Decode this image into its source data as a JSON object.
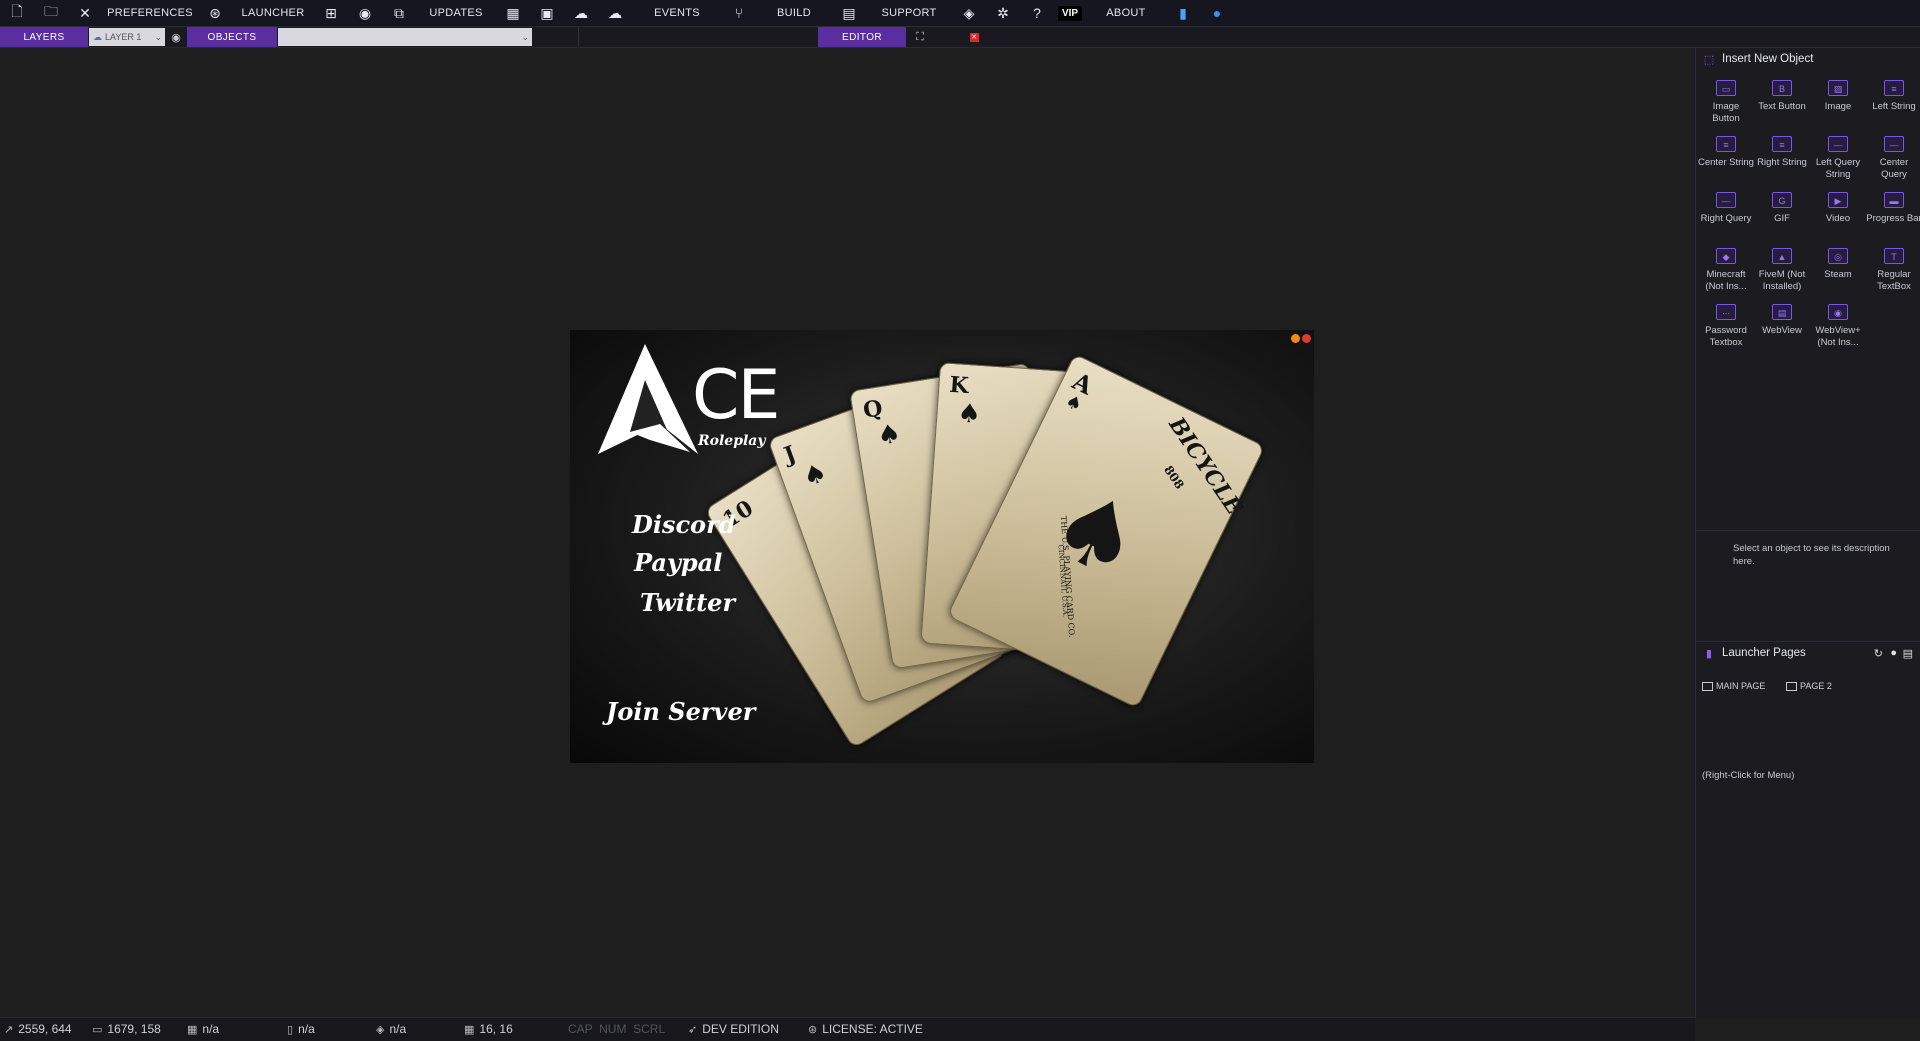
{
  "menubar": {
    "items": [
      {
        "type": "icon",
        "name": "new-file-icon",
        "glyph": "🗋"
      },
      {
        "type": "icon",
        "name": "open-folder-icon",
        "glyph": "🗀"
      },
      {
        "type": "icon",
        "name": "close-x-icon",
        "glyph": "✕"
      },
      {
        "type": "text",
        "label": "PREFERENCES"
      },
      {
        "type": "icon",
        "name": "globe-settings-icon",
        "glyph": "⊛"
      },
      {
        "type": "text",
        "label": "LAUNCHER"
      },
      {
        "type": "icon",
        "name": "hierarchy-icon",
        "glyph": "⊞"
      },
      {
        "type": "icon",
        "name": "record-icon",
        "glyph": "◉"
      },
      {
        "type": "icon",
        "name": "preview-window-icon",
        "glyph": "⧉"
      },
      {
        "type": "text",
        "label": "UPDATES"
      },
      {
        "type": "icon",
        "name": "grid-icon",
        "glyph": "▦"
      },
      {
        "type": "icon",
        "name": "archive-icon",
        "glyph": "▣"
      },
      {
        "type": "icon",
        "name": "cloud-upload-icon",
        "glyph": "☁"
      },
      {
        "type": "icon",
        "name": "cloud-icon",
        "glyph": "☁"
      },
      {
        "type": "text",
        "label": "EVENTS"
      },
      {
        "type": "icon",
        "name": "branch-icon",
        "glyph": "⑂"
      },
      {
        "type": "text",
        "label": "BUILD"
      },
      {
        "type": "icon",
        "name": "package-icon",
        "glyph": "▤"
      },
      {
        "type": "text",
        "label": "SUPPORT"
      },
      {
        "type": "icon",
        "name": "discord-icon",
        "glyph": "◈"
      },
      {
        "type": "icon",
        "name": "bug-icon",
        "glyph": "✲"
      },
      {
        "type": "icon",
        "name": "help-icon",
        "glyph": "?"
      },
      {
        "type": "vip",
        "label": "VIP"
      },
      {
        "type": "text",
        "label": "ABOUT"
      },
      {
        "type": "icon",
        "name": "book-icon",
        "glyph": "▮"
      },
      {
        "type": "icon",
        "name": "user-circle-icon",
        "glyph": "●"
      }
    ]
  },
  "toolbar": {
    "layers_label": "LAYERS",
    "layer_value": "LAYER 1",
    "objects_label": "OBJECTS",
    "objects_value": "",
    "editor_label": "EDITOR"
  },
  "launcher": {
    "logo_text": "CE",
    "logo_sub": "Roleplay",
    "links": [
      "Discord",
      "Paypal",
      "Twitter"
    ],
    "join": "Join Server",
    "card_brand": "BICYCLE",
    "card_num": "808",
    "card_maker": "THE U.S. PLAYING CARD CO.",
    "card_city": "CINCINNATI, U.S.A."
  },
  "insert_panel": {
    "title": "Insert New Object",
    "objects": [
      {
        "label": "Image Button",
        "icon": "image-button-icon",
        "glyph": "▭"
      },
      {
        "label": "Text Button",
        "icon": "text-button-icon",
        "glyph": "B"
      },
      {
        "label": "Image",
        "icon": "image-icon",
        "glyph": "▨"
      },
      {
        "label": "Left String",
        "icon": "left-string-icon",
        "glyph": "≡"
      },
      {
        "label": "Center String",
        "icon": "center-string-icon",
        "glyph": "≡"
      },
      {
        "label": "Right String",
        "icon": "right-string-icon",
        "glyph": "≡"
      },
      {
        "label": "Left Query String",
        "icon": "left-query-icon",
        "glyph": "—"
      },
      {
        "label": "Center Query",
        "icon": "center-query-icon",
        "glyph": "—"
      },
      {
        "label": "Right Query",
        "icon": "right-query-icon",
        "glyph": "—"
      },
      {
        "label": "GIF",
        "icon": "gif-icon",
        "glyph": "G"
      },
      {
        "label": "Video",
        "icon": "video-icon",
        "glyph": "▶"
      },
      {
        "label": "Progress Bar",
        "icon": "progress-bar-icon",
        "glyph": "▬"
      },
      {
        "label": "Minecraft (Not Ins...",
        "icon": "minecraft-icon",
        "glyph": "◆"
      },
      {
        "label": "FiveM (Not Installed)",
        "icon": "fivem-icon",
        "glyph": "▲"
      },
      {
        "label": "Steam",
        "icon": "steam-icon",
        "glyph": "◎"
      },
      {
        "label": "Regular TextBox",
        "icon": "textbox-icon",
        "glyph": "T"
      },
      {
        "label": "Password Textbox",
        "icon": "password-textbox-icon",
        "glyph": "∙∙∙"
      },
      {
        "label": "WebView",
        "icon": "webview-icon",
        "glyph": "▤"
      },
      {
        "label": "WebView+ (Not Ins...",
        "icon": "webview-plus-icon",
        "glyph": "◉"
      }
    ],
    "description": "Select an object to see its description here."
  },
  "pages_panel": {
    "title": "Launcher Pages",
    "pages": [
      "MAIN PAGE",
      "PAGE 2"
    ],
    "hint": "(Right-Click for Menu)"
  },
  "statusbar": {
    "cursor": "2559, 644",
    "size": "1679, 158",
    "obj1": "n/a",
    "obj2": "n/a",
    "obj3": "n/a",
    "grid": "16, 16",
    "keys": "CAP  NUM  SCRL",
    "edition": "DEV EDITION",
    "license": "LICENSE: ACTIVE"
  },
  "colors": {
    "accent": "#5a2ea0",
    "icon_accent": "#8d5cf0",
    "close_red": "#e02828"
  }
}
